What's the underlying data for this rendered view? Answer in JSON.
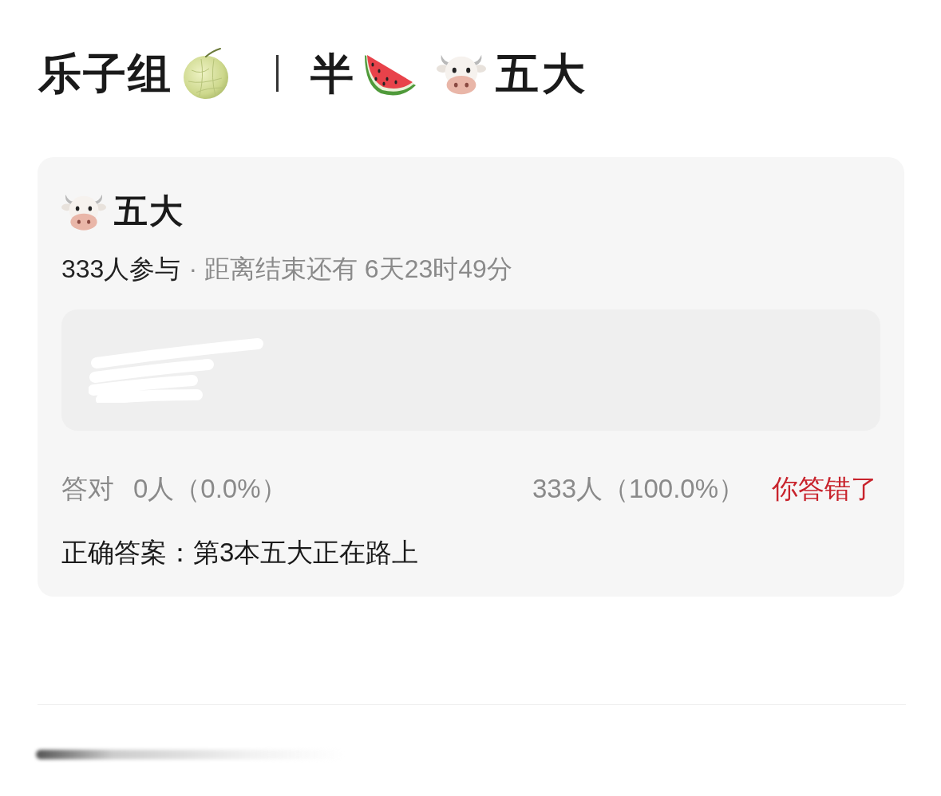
{
  "header": {
    "group_name": "乐子组",
    "subtitle": "半",
    "topic": "五大"
  },
  "quiz": {
    "title": "五大",
    "participants": "333人参与",
    "deadline": "· 距离结束还有 6天23时49分",
    "stats": {
      "correct_label": "答对",
      "correct_count": "0人（0.0%）",
      "wrong_count": "333人（100.0%）"
    },
    "result": {
      "text": "你答错了",
      "correct": false
    },
    "answer": "正确答案：第3本五大正在路上"
  }
}
